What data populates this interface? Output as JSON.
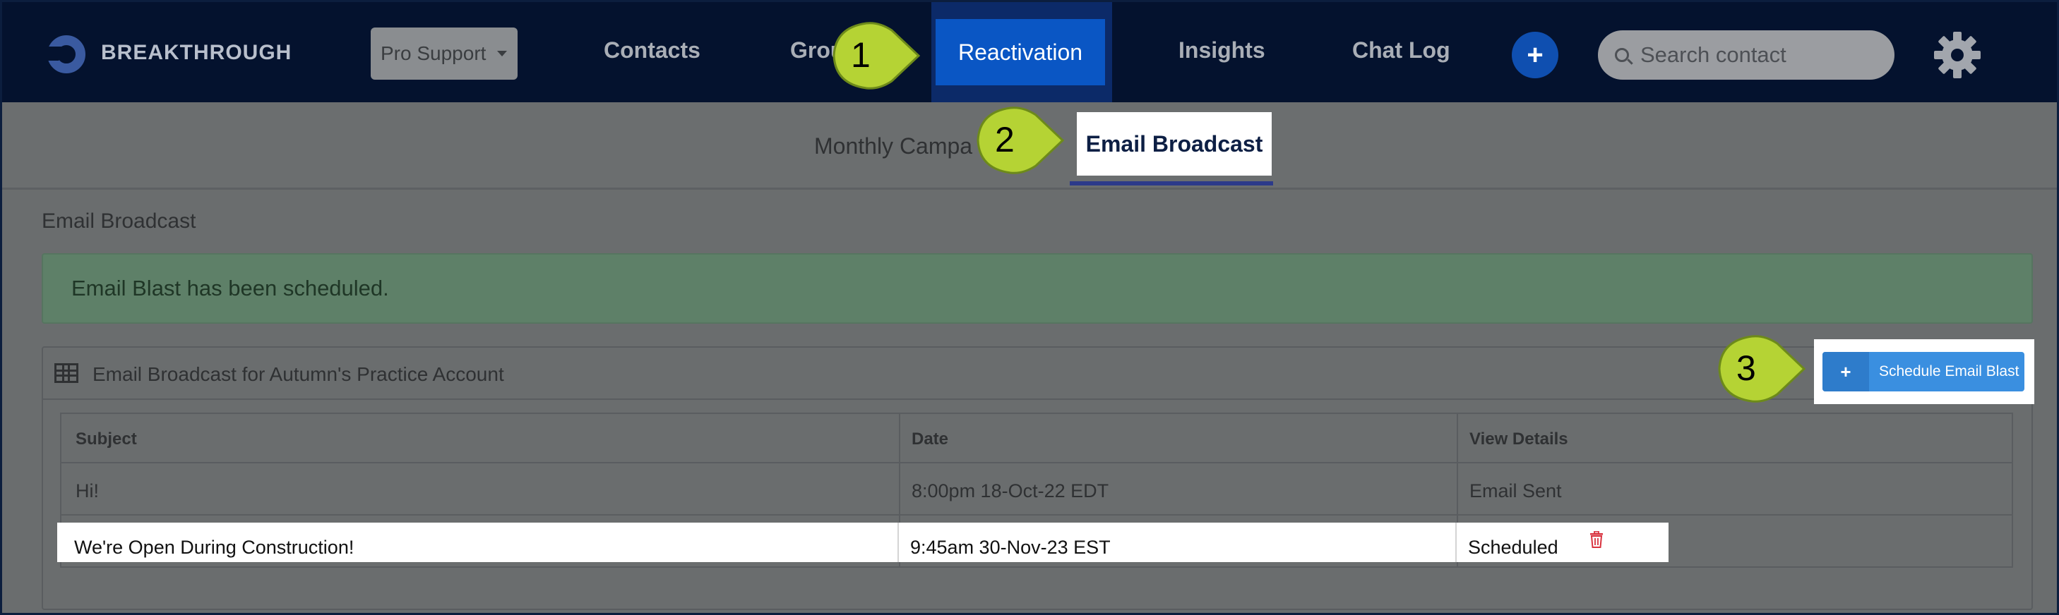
{
  "brand": {
    "name": "BREAKTHROUGH"
  },
  "account_menu": {
    "label": "Pro Support"
  },
  "nav": {
    "contacts": "Contacts",
    "groups": "Grou",
    "reactivation": "Reactivation",
    "insights": "Insights",
    "chat_log": "Chat Log"
  },
  "search": {
    "placeholder": "Search contact"
  },
  "subnav": {
    "monthly": "Monthly Campa",
    "email_broadcast": "Email Broadcast"
  },
  "section_title": "Email Broadcast",
  "alert": "Email Blast has been scheduled.",
  "panel": {
    "title": "Email Broadcast for Autumn's Practice Account"
  },
  "schedule_button": {
    "plus": "+",
    "label": "Schedule Email Blast"
  },
  "table": {
    "headers": [
      "Subject",
      "Date",
      "View Details"
    ],
    "rows": [
      [
        "Hi!",
        "8:00pm 18-Oct-22 EDT",
        "Email Sent"
      ],
      [
        "We're Open During Construction!",
        "9:45am 30-Nov-23 EST",
        "Scheduled"
      ]
    ]
  },
  "callouts": [
    "1",
    "2",
    "3"
  ],
  "colors": {
    "nav_bg": "#04122e",
    "active_tab": "#0a56c4",
    "callout": "#b5d334",
    "button": "#3a8fe0",
    "alert_green": "#5e8068",
    "trash_red": "#d9333f"
  }
}
